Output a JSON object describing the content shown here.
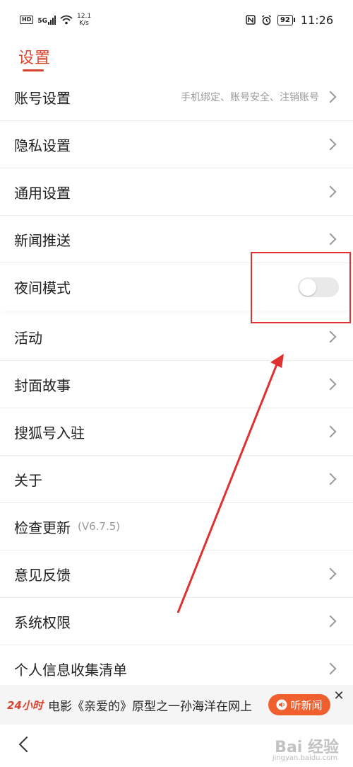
{
  "status_bar": {
    "hd": "HD",
    "network": "5G",
    "speed_value": "12.1",
    "speed_unit": "K/s",
    "battery": "92",
    "time": "11:26"
  },
  "header": {
    "title": "设置"
  },
  "settings": {
    "account": {
      "label": "账号设置",
      "subtitle": "手机绑定、账号安全、注销账号"
    },
    "privacy": {
      "label": "隐私设置"
    },
    "general": {
      "label": "通用设置"
    },
    "push": {
      "label": "新闻推送"
    },
    "night_mode": {
      "label": "夜间模式",
      "enabled": false
    },
    "activity": {
      "label": "活动"
    },
    "cover_story": {
      "label": "封面故事"
    },
    "sohu_account": {
      "label": "搜狐号入驻"
    },
    "about": {
      "label": "关于"
    },
    "check_update": {
      "label": "检查更新",
      "version": "(V6.7.5)"
    },
    "feedback": {
      "label": "意见反馈"
    },
    "permissions": {
      "label": "系统权限"
    },
    "personal_info": {
      "label": "个人信息收集清单"
    }
  },
  "news_bar": {
    "logo": "24小时",
    "headline": "电影《亲爱的》原型之一孙海洋在网上",
    "listen_label": "听新闻",
    "close_symbol": "✕"
  },
  "watermark": {
    "text": "Bai 经验",
    "sub": "jingyan.baidu.com"
  },
  "colors": {
    "accent": "#d9432d",
    "listen_button": "#f0602e",
    "annotation": "#e03030"
  }
}
